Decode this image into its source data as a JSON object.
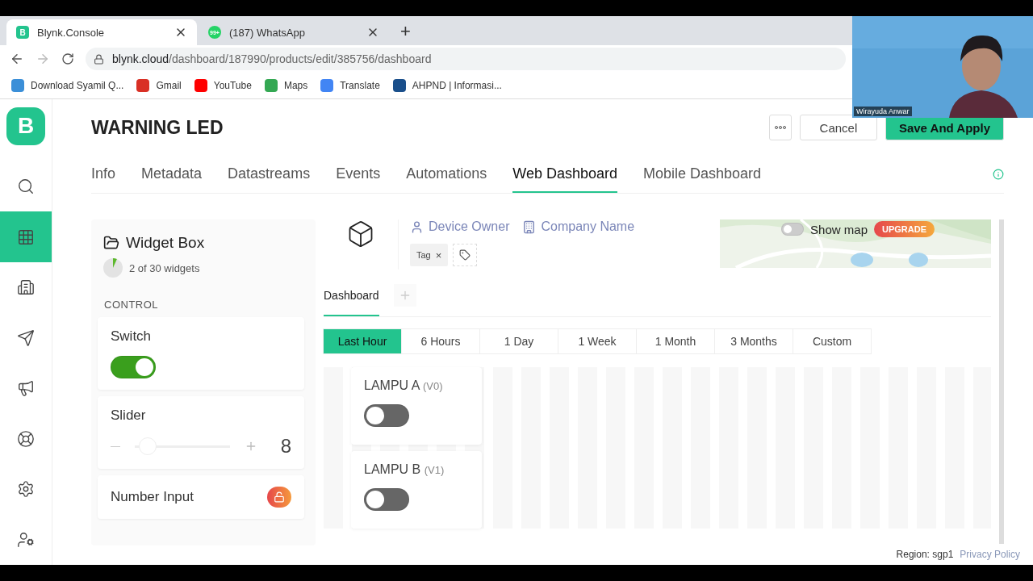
{
  "browser": {
    "tabs": [
      {
        "title": "Blynk.Console",
        "badge": "B",
        "selected": true
      },
      {
        "title": "(187) WhatsApp",
        "badge": "99+",
        "selected": false
      }
    ],
    "new_tab": "+",
    "url_host": "blynk.cloud",
    "url_path": "/dashboard/187990/products/edit/385756/dashboard",
    "bookmarks": [
      {
        "label": "Download Syamil Q...",
        "color": "#3b8fd8"
      },
      {
        "label": "Gmail",
        "color": "#d93025"
      },
      {
        "label": "YouTube",
        "color": "#ff0000"
      },
      {
        "label": "Maps",
        "color": "#34a853"
      },
      {
        "label": "Translate",
        "color": "#4285f4"
      },
      {
        "label": "AHPND | Informasi...",
        "color": "#1a4f8b"
      }
    ]
  },
  "video_call": {
    "name": "Wirayuda Anwar",
    "kind": "picture"
  },
  "sidebar": {
    "logo": "B",
    "items": [
      {
        "kind": "search",
        "selected": false
      },
      {
        "kind": "grid",
        "selected": true
      },
      {
        "kind": "building",
        "selected": false
      },
      {
        "kind": "send",
        "selected": false
      },
      {
        "kind": "megaphone",
        "selected": false
      },
      {
        "kind": "lifebuoy",
        "selected": false
      },
      {
        "kind": "settings",
        "selected": false
      },
      {
        "kind": "user",
        "selected": false
      }
    ]
  },
  "header": {
    "title": "WARNING LED",
    "buttons": [
      {
        "kind": "more"
      },
      {
        "kind": "secondary",
        "label": "Cancel"
      },
      {
        "kind": "primary",
        "label": "Save And Apply"
      }
    ]
  },
  "tabs": [
    {
      "label": "Info",
      "selected": false
    },
    {
      "label": "Metadata",
      "selected": false
    },
    {
      "label": "Datastreams",
      "selected": false
    },
    {
      "label": "Events",
      "selected": false
    },
    {
      "label": "Automations",
      "selected": false
    },
    {
      "label": "Web Dashboard",
      "selected": true
    },
    {
      "label": "Mobile Dashboard",
      "selected": false
    }
  ],
  "widget_box": {
    "title": "Widget Box",
    "count": "2 of 30 widgets",
    "section": "CONTROL",
    "widgets": [
      {
        "kind": "switch",
        "name": "Switch",
        "on": true
      },
      {
        "kind": "slider",
        "name": "Slider",
        "value": "8",
        "level": 0.05
      },
      {
        "kind": "number",
        "name": "Number Input",
        "locked": true
      }
    ]
  },
  "device": {
    "owner": "Device Owner",
    "company": "Company Name",
    "tags": [
      {
        "label": "Tag",
        "close": "×"
      }
    ],
    "map": {
      "kind": "picture",
      "toggle_label": "Show map",
      "on": false,
      "badge": "UPGRADE"
    }
  },
  "dashboard_tabs": [
    {
      "label": "Dashboard",
      "selected": true
    }
  ],
  "time_ranges": [
    {
      "label": "Last Hour",
      "selected": true
    },
    {
      "label": "6 Hours",
      "selected": false
    },
    {
      "label": "1 Day",
      "selected": false
    },
    {
      "label": "1 Week",
      "selected": false
    },
    {
      "label": "1 Month",
      "selected": false
    },
    {
      "label": "3 Months",
      "selected": false
    },
    {
      "label": "Custom",
      "selected": false
    }
  ],
  "dashboard_widgets": [
    {
      "label": "LAMPU A",
      "pin": "(V0)",
      "on": false
    },
    {
      "label": "LAMPU B",
      "pin": "(V1)",
      "on": false
    }
  ],
  "footer": {
    "region": "Region: sgp1",
    "link": "Privacy Policy"
  }
}
